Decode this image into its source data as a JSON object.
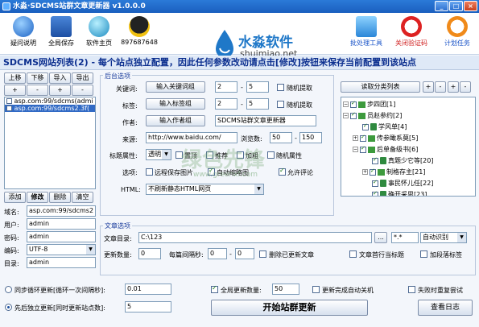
{
  "window": {
    "title": "水淼·SDCMS站群文章更新器 v1.0.0.0",
    "min": "_",
    "max": "□",
    "close": "×"
  },
  "toolbar": {
    "help": "疑问说明",
    "save": "全局保存",
    "home": "软件主页",
    "qq": "897687648",
    "bulk": "批处理工具",
    "captcha": "关闭验证码",
    "schedule": "计划任务"
  },
  "logo": {
    "name": "水淼软件",
    "domain": "shuimiao.net"
  },
  "banner": "SDCMS网站列表(2) - 每个站点独立配置，因此任何参数改动请点击[修改]按钮来保存当前配置到该站点",
  "site_list": {
    "buttons": [
      "上移",
      "下移",
      "导入",
      "导出"
    ],
    "plus": "+",
    "minus": "-",
    "items": [
      "asp.com:99/sdcms(admi",
      "asp.com:99/sdcms2.3f("
    ],
    "selected_index": 1,
    "actions": [
      "添加",
      "修改",
      "删除",
      "清空"
    ]
  },
  "site_form": {
    "domain_label": "域名:",
    "domain_value": "asp.com:99/sdcms2",
    "user_label": "用户:",
    "user_value": "admin",
    "pwd_label": "密码:",
    "pwd_value": "admin",
    "enc_label": "编码:",
    "enc_value": "UTF-8",
    "dir_label": "目录:",
    "dir_value": "admin"
  },
  "backend": {
    "section_title": "后台选项",
    "keyword_label": "关键词:",
    "keyword_btn": "输入关键词组",
    "keyword_min": "2",
    "keyword_max": "5",
    "keyword_random": "随机提取",
    "tag_label": "标签:",
    "tag_btn": "输入标签组",
    "tag_min": "2",
    "tag_max": "5",
    "tag_random": "随机提取",
    "author_label": "作者:",
    "author_btn": "输入作者组",
    "author_value": "SDCMS站群文章更新器",
    "source_label": "来源:",
    "source_value": "http://www.baidu.com/",
    "views_label": "浏览数:",
    "views_min": "50",
    "views_max": "150",
    "title_attr_label": "标题属性:",
    "title_attr_value": "透明",
    "attrs": [
      "置顶",
      "推荐",
      "加粗",
      "随机属性"
    ],
    "options_label": "选项:",
    "options": [
      "远程保存图片",
      "自动缩略图",
      "允许评论"
    ],
    "html_label": "HTML:",
    "html_value": "不刷新静态HTML网页"
  },
  "article": {
    "section_title": "文章选项",
    "dir_label": "文章目录:",
    "dir_value": "C:\\123",
    "browse": "...",
    "ext_value": "*.*",
    "detect_value": "自动识别",
    "update_count_label": "更新数量:",
    "update_count": "0",
    "interval_label": "每篇间隔秒:",
    "interval_min": "0",
    "interval_max": "0",
    "delete_after": "删除已更新文章",
    "first_line_title": "文章首行当标题",
    "add_paragraph": "加段落标签"
  },
  "category": {
    "read_btn": "读取分类列表",
    "plus": "+",
    "minus": "-"
  },
  "tree": [
    {
      "label": "步四团[1]",
      "level": 0,
      "kind": "folder",
      "expanded": true
    },
    {
      "label": "员赵参约[2]",
      "level": 0,
      "kind": "folder",
      "expanded": true
    },
    {
      "label": "学风单[4]",
      "level": 1,
      "kind": "doc"
    },
    {
      "label": "传参瞰系莫[5]",
      "level": 1,
      "kind": "folder"
    },
    {
      "label": "后单备级书[6]",
      "level": 1,
      "kind": "folder",
      "expanded": true
    },
    {
      "label": "真题少它等[20]",
      "level": 2,
      "kind": "doc"
    },
    {
      "label": "制格存主[21]",
      "level": 2,
      "kind": "folder"
    },
    {
      "label": "事民怀儿任[22]",
      "level": 2,
      "kind": "doc"
    },
    {
      "label": "确开采思[23]",
      "level": 2,
      "kind": "doc"
    }
  ],
  "bottom": {
    "sync_label": "同步循环更新[循环一次间隔秒]:",
    "sync_value": "0.01",
    "seq_label": "先后独立更新[同时更新站点数]:",
    "seq_value": "5",
    "global_count_label": "全局更新数量:",
    "global_count": "50",
    "shutdown_label": "更新完成自动关机",
    "retry_label": "失败时重复尝试",
    "start_btn": "开始站群更新",
    "log_btn": "查看日志"
  },
  "watermark": {
    "brand": "绿色先锋",
    "url": "www.greenxf.com"
  },
  "colors": {
    "title_bar": "#1a5fbf",
    "banner_text": "#0c2f8f",
    "section_title": "#1a3c9c",
    "selection": "#316ac5"
  }
}
